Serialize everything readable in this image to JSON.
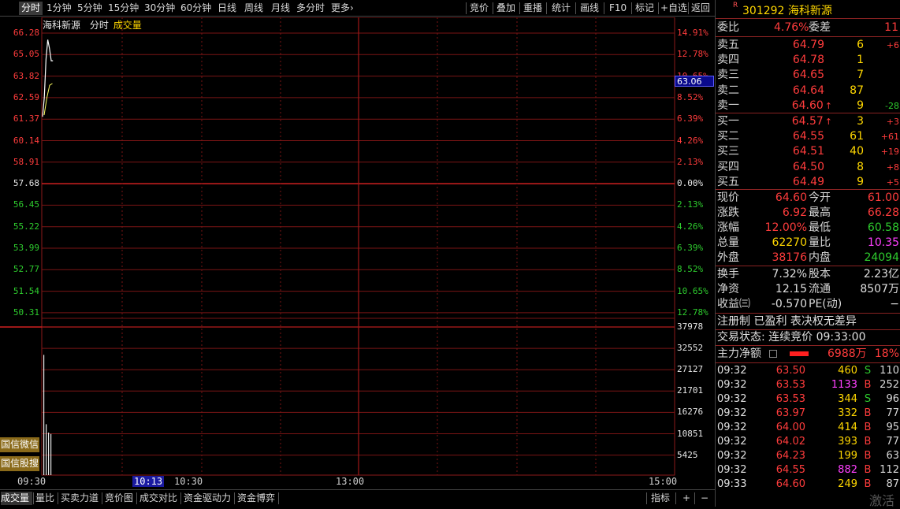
{
  "toolbar": {
    "tabs": [
      "分时",
      "1分钟",
      "5分钟",
      "15分钟",
      "30分钟",
      "60分钟",
      "日线",
      "周线",
      "月线",
      "多分时",
      "更多"
    ],
    "more_arrow": "›",
    "right": [
      "竞价",
      "叠加",
      "重播",
      "统计",
      "画线",
      "F10",
      "标记",
      "+自选",
      "返回"
    ]
  },
  "chart": {
    "header": {
      "name": "海科新源",
      "mode": "分时",
      "indicator": "成交量"
    },
    "price_labels": [
      "66.28",
      "65.05",
      "63.82",
      "62.59",
      "61.37",
      "60.14",
      "58.91",
      "57.68",
      "56.45",
      "55.22",
      "53.99",
      "52.77",
      "51.54",
      "50.31"
    ],
    "pct_labels": [
      "14.91%",
      "12.78%",
      "10.65%",
      "8.52%",
      "6.39%",
      "4.26%",
      "2.13%",
      "0.00%",
      "2.13%",
      "4.26%",
      "6.39%",
      "8.52%",
      "10.65%",
      "12.78%"
    ],
    "volume_labels": [
      "37978",
      "32552",
      "27127",
      "21701",
      "16276",
      "10851",
      "5425"
    ],
    "current_price_tag": "63.06",
    "time_labels": [
      "09:30",
      "10:13",
      "10:30",
      "13:00",
      "15:00"
    ],
    "side_badges": [
      "国信微信",
      "国信股搜"
    ],
    "price_line": [
      61.5,
      62.6,
      64.8,
      65.9,
      65.4,
      64.7,
      64.7
    ],
    "price_line2": [
      61.6,
      62.6,
      63.3,
      63.4
    ],
    "volume_bars": [
      34500,
      14600,
      12200,
      11800
    ]
  },
  "bottom_tabs": [
    "成交量",
    "量比",
    "买卖力道",
    "竞价图",
    "成交对比",
    "资金驱动力",
    "资金博弈"
  ],
  "bottom_right": [
    "指标",
    "+",
    "−"
  ],
  "watermark": "激活",
  "panel": {
    "r_badge": "R",
    "code_name": "301292 海科新源",
    "weibi": {
      "label": "委比",
      "value": "4.76%",
      "label2": "委差",
      "value2": "11"
    },
    "sell": [
      {
        "label": "卖五",
        "price": "64.79",
        "vol": "6",
        "chg": "+6",
        "arrow": ""
      },
      {
        "label": "卖四",
        "price": "64.78",
        "vol": "1",
        "chg": "",
        "arrow": ""
      },
      {
        "label": "卖三",
        "price": "64.65",
        "vol": "7",
        "chg": "",
        "arrow": ""
      },
      {
        "label": "卖二",
        "price": "64.64",
        "vol": "87",
        "chg": "",
        "arrow": ""
      },
      {
        "label": "卖一",
        "price": "64.60",
        "vol": "9",
        "chg": "-28",
        "arrow": "↑"
      }
    ],
    "buy": [
      {
        "label": "买一",
        "price": "64.57",
        "vol": "3",
        "chg": "+3",
        "arrow": "↑"
      },
      {
        "label": "买二",
        "price": "64.55",
        "vol": "61",
        "chg": "+61",
        "arrow": ""
      },
      {
        "label": "买三",
        "price": "64.51",
        "vol": "40",
        "chg": "+19",
        "arrow": ""
      },
      {
        "label": "买四",
        "price": "64.50",
        "vol": "8",
        "chg": "+8",
        "arrow": ""
      },
      {
        "label": "买五",
        "price": "64.49",
        "vol": "9",
        "chg": "+5",
        "arrow": ""
      }
    ],
    "quote": [
      {
        "l1": "现价",
        "v1": "64.60",
        "l2": "今开",
        "v2": "61.00"
      },
      {
        "l1": "涨跌",
        "v1": "6.92",
        "l2": "最高",
        "v2": "66.28"
      },
      {
        "l1": "涨幅",
        "v1": "12.00%",
        "l2": "最低",
        "v2": "60.58"
      },
      {
        "l1": "总量",
        "v1": "62270",
        "l2": "量比",
        "v2": "10.35"
      },
      {
        "l1": "外盘",
        "v1": "38176",
        "l2": "内盘",
        "v2": "24094"
      }
    ],
    "fund": [
      {
        "l1": "换手",
        "v1": "7.32%",
        "l2": "股本",
        "v2": "2.23亿"
      },
      {
        "l1": "净资",
        "v1": "12.15",
        "l2": "流通",
        "v2": "8507万"
      },
      {
        "l1": "收益㈢",
        "v1": "-0.570",
        "l2": "PE(动)",
        "v2": "−"
      }
    ],
    "tags": "注册制 已盈利 表决权无差异",
    "trade_status": "交易状态: 连续竞价 09:33:00",
    "main_force": {
      "label": "主力净额",
      "value": "6988万",
      "pct": "18%"
    },
    "trades": [
      {
        "time": "09:32",
        "price": "63.50",
        "vol": "460",
        "bs": "S",
        "cnt": "110"
      },
      {
        "time": "09:32",
        "price": "63.53",
        "vol": "1133",
        "bs": "B",
        "cnt": "252"
      },
      {
        "time": "09:32",
        "price": "63.53",
        "vol": "344",
        "bs": "S",
        "cnt": "96"
      },
      {
        "time": "09:32",
        "price": "63.97",
        "vol": "332",
        "bs": "B",
        "cnt": "77"
      },
      {
        "time": "09:32",
        "price": "64.00",
        "vol": "414",
        "bs": "B",
        "cnt": "95"
      },
      {
        "time": "09:32",
        "price": "64.02",
        "vol": "393",
        "bs": "B",
        "cnt": "77"
      },
      {
        "time": "09:32",
        "price": "64.23",
        "vol": "199",
        "bs": "B",
        "cnt": "63"
      },
      {
        "time": "09:32",
        "price": "64.55",
        "vol": "882",
        "bs": "B",
        "cnt": "112"
      },
      {
        "time": "09:33",
        "price": "64.60",
        "vol": "249",
        "bs": "B",
        "cnt": "87"
      }
    ]
  }
}
